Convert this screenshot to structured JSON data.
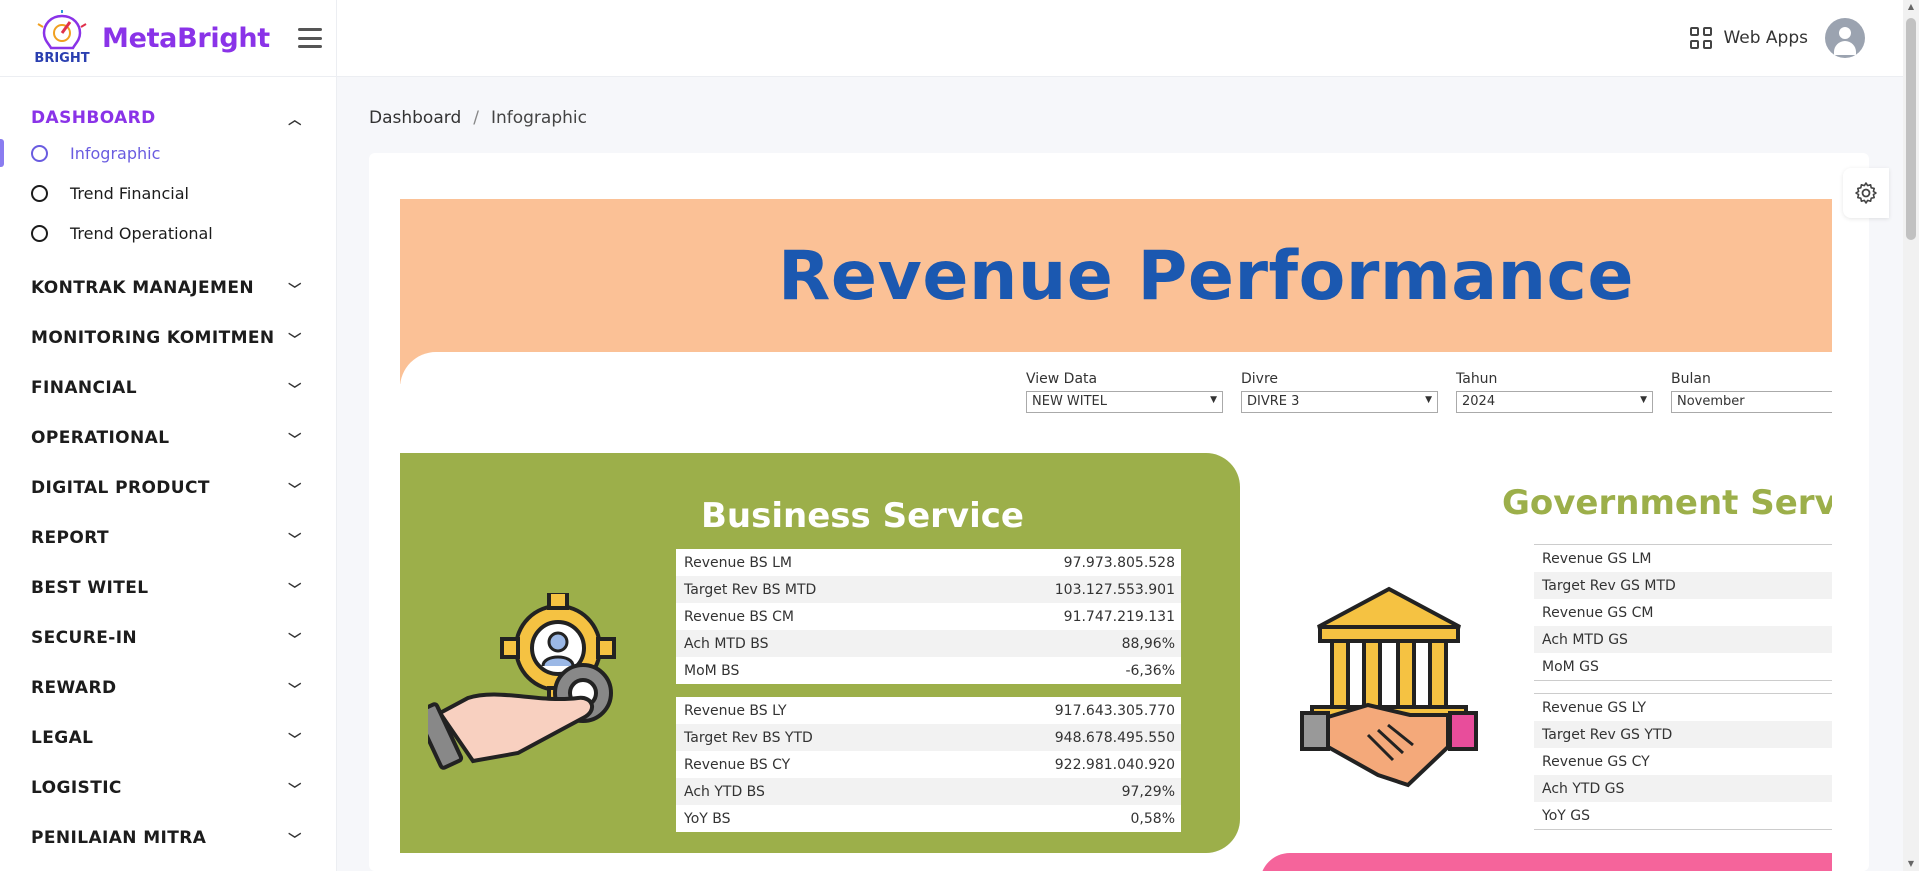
{
  "brand": {
    "name": "MetaBright",
    "logo_text": "BRIGHT"
  },
  "sidebar": {
    "dashboard": {
      "label": "DASHBOARD",
      "items": [
        {
          "label": "Infographic",
          "active": true
        },
        {
          "label": "Trend Financial"
        },
        {
          "label": "Trend Operational"
        }
      ]
    },
    "sections": [
      "KONTRAK MANAJEMEN",
      "MONITORING KOMITMEN",
      "FINANCIAL",
      "OPERATIONAL",
      "DIGITAL PRODUCT",
      "REPORT",
      "BEST WITEL",
      "SECURE-IN",
      "REWARD",
      "LEGAL",
      "LOGISTIC",
      "PENILAIAN MITRA"
    ]
  },
  "topbar": {
    "webapps_label": "Web Apps"
  },
  "breadcrumb": {
    "root": "Dashboard",
    "separator": "/",
    "current": "Infographic"
  },
  "viz": {
    "title": "Revenue Performance",
    "filters": [
      {
        "label": "View Data",
        "value": "NEW WITEL"
      },
      {
        "label": "Divre",
        "value": "DIVRE 3"
      },
      {
        "label": "Tahun",
        "value": "2024"
      },
      {
        "label": "Bulan",
        "value": "November"
      }
    ],
    "business_service": {
      "title": "Business Service",
      "monthly": [
        {
          "label": "Revenue BS LM",
          "value": "97.973.805.528"
        },
        {
          "label": "Target Rev BS MTD",
          "value": "103.127.553.901"
        },
        {
          "label": "Revenue BS CM",
          "value": "91.747.219.131"
        },
        {
          "label": "Ach MTD BS",
          "value": "88,96%"
        },
        {
          "label": "MoM BS",
          "value": "-6,36%"
        }
      ],
      "yearly": [
        {
          "label": "Revenue BS LY",
          "value": "917.643.305.770"
        },
        {
          "label": "Target Rev BS YTD",
          "value": "948.678.495.550"
        },
        {
          "label": "Revenue BS CY",
          "value": "922.981.040.920"
        },
        {
          "label": "Ach YTD BS",
          "value": "97,29%"
        },
        {
          "label": "YoY BS",
          "value": "0,58%"
        }
      ]
    },
    "government_service": {
      "title": "Government Service",
      "monthly": [
        {
          "label": "Revenue GS LM"
        },
        {
          "label": "Target Rev GS MTD"
        },
        {
          "label": "Revenue GS CM"
        },
        {
          "label": "Ach MTD GS"
        },
        {
          "label": "MoM GS"
        }
      ],
      "yearly": [
        {
          "label": "Revenue GS LY"
        },
        {
          "label": "Target Rev GS YTD"
        },
        {
          "label": "Revenue GS CY"
        },
        {
          "label": "Ach YTD GS"
        },
        {
          "label": "YoY GS"
        }
      ]
    }
  },
  "colors": {
    "brand": "#8a33e8",
    "banner": "#fbc196",
    "title_blue": "#1b58b0",
    "bs_green": "#9caf4a",
    "pink": "#f5649b"
  }
}
